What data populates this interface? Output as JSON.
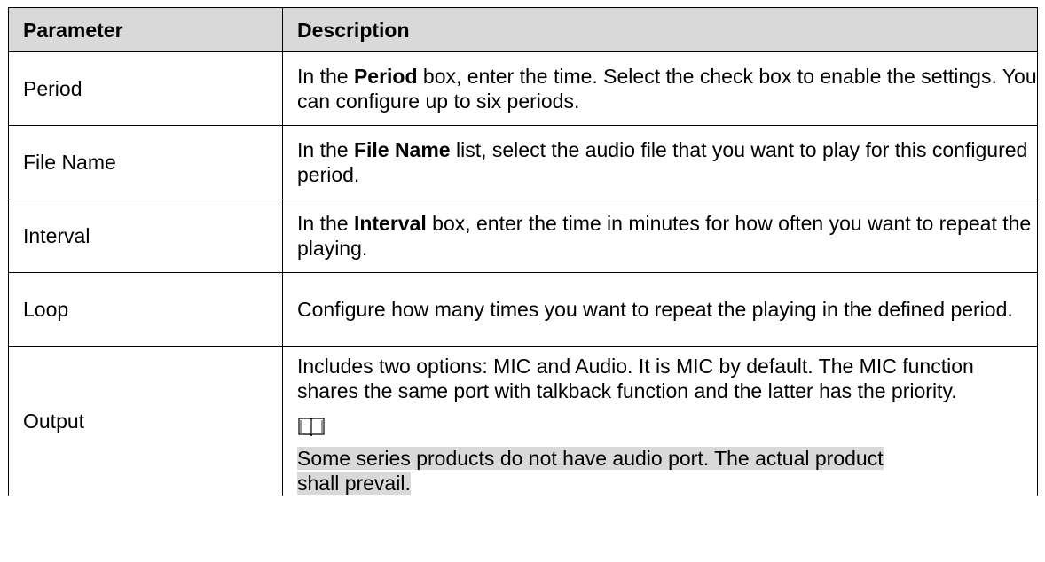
{
  "header": {
    "parameter": "Parameter",
    "description": "Description"
  },
  "rows": [
    {
      "parameter": "Period",
      "desc_before": "In the ",
      "desc_bold": "Period",
      "desc_after": " box, enter the time. Select the check box to enable the settings. You can configure up to six periods."
    },
    {
      "parameter": "File Name",
      "desc_before": "In the ",
      "desc_bold": "File Name",
      "desc_after": " list, select the audio file that you want to play for this configured period."
    },
    {
      "parameter": "Interval",
      "desc_before": "In the ",
      "desc_bold": "Interval",
      "desc_after": " box, enter the time in minutes for how often you want to repeat the playing."
    },
    {
      "parameter": "Loop",
      "desc": "Configure how many times you want to repeat the playing in the defined period."
    },
    {
      "parameter": "Output",
      "desc": "Includes two options: MIC and Audio. It is MIC by default. The MIC function shares the same port with talkback function and the latter has the priority.",
      "note_icon": "book-icon",
      "note_line1": "Some series products do not have audio port. The actual product",
      "note_line2": "shall prevail."
    }
  ]
}
